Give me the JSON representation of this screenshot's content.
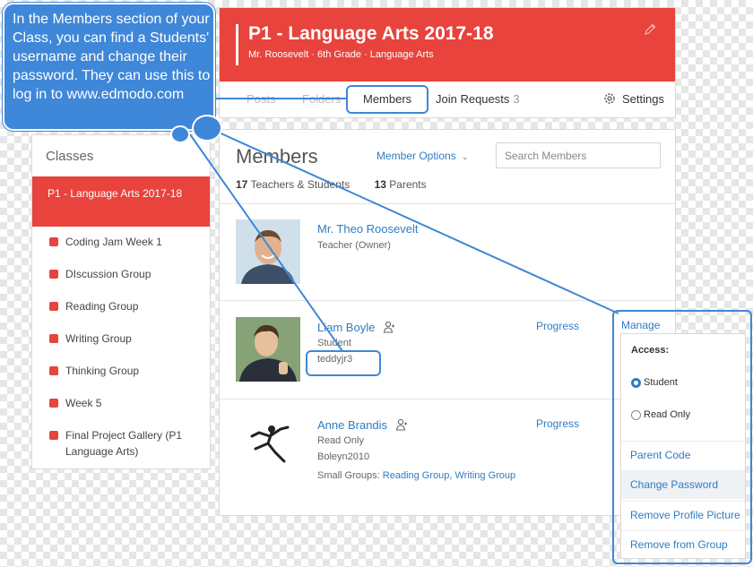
{
  "callout": {
    "text": "In the Members section of your Class, you can find a Students' username and change their password. They can use this to log in to www.edmodo.com"
  },
  "header": {
    "title": "P1 - Language Arts 2017-18",
    "subtitle": "Mr. Roosevelt · 6th Grade · Language Arts",
    "tabs": {
      "posts": "Posts",
      "folders": "Folders",
      "members": "Members",
      "join_requests": "Join Requests",
      "join_requests_count": "3",
      "settings": "Settings"
    }
  },
  "sidebar": {
    "title": "Classes",
    "active": "P1 - Language Arts 2017-18",
    "items": [
      "Coding Jam Week 1",
      "DIscussion Group",
      "Reading Group",
      "Writing Group",
      "Thinking Group",
      "Week 5",
      "Final Project Gallery (P1 Language Arts)"
    ]
  },
  "members": {
    "title": "Members",
    "options_label": "Member Options",
    "search_placeholder": "Search Members",
    "teachers_count": "17",
    "teachers_label": "Teachers & Students",
    "parents_count": "13",
    "parents_label": "Parents",
    "list": [
      {
        "name": "Mr. Theo Roosevelt",
        "role": "Teacher (Owner)"
      },
      {
        "name": "Liam Boyle",
        "role": "Student",
        "username": "teddyjr3",
        "progress": "Progress",
        "manage": "Manage"
      },
      {
        "name": "Anne Brandis",
        "role": "Read Only",
        "username": "Boleyn2010",
        "groups_label": "Small Groups:",
        "group1": "Reading Group,",
        "group2": "Writing Group",
        "progress": "Progress"
      }
    ]
  },
  "dropdown": {
    "access_label": "Access:",
    "options": [
      "Student",
      "Read Only"
    ],
    "selected": "Student",
    "links": [
      "Parent Code",
      "Change Password",
      "Remove Profile Picture",
      "Remove from Group"
    ]
  },
  "colors": {
    "brand_red": "#e8433c",
    "link_blue": "#2f7cc1",
    "callout_blue": "#3f87d8"
  }
}
